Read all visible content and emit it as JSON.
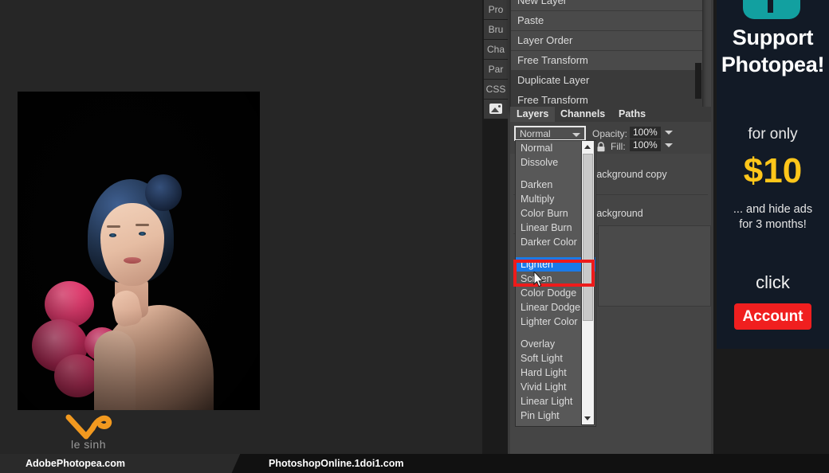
{
  "app": {
    "name": "Photopea"
  },
  "canvas": {
    "watermark_text": "le sinh",
    "logo_icon": "checkmark-swoosh-logo"
  },
  "banner": {
    "left_label": "AdobePhotopea.com",
    "right_label": "PhotoshopOnline.1doi1.com"
  },
  "tabstrip": {
    "items": [
      {
        "label": "Pro",
        "name": "properties"
      },
      {
        "label": "Bru",
        "name": "brushes"
      },
      {
        "label": "Cha",
        "name": "character"
      },
      {
        "label": "Par",
        "name": "paragraph"
      },
      {
        "label": "CSS",
        "name": "css"
      }
    ],
    "image_icon": "image-icon"
  },
  "context_menu": {
    "items": [
      {
        "label": "New Layer",
        "hovered": false
      },
      {
        "label": "Paste",
        "hovered": false
      },
      {
        "label": "Layer Order",
        "hovered": false
      },
      {
        "label": "Free Transform",
        "hovered": false
      },
      {
        "label": "Duplicate Layer",
        "hovered": true
      },
      {
        "label": "Free Transform",
        "hovered": true
      }
    ]
  },
  "panel": {
    "tabs": [
      {
        "label": "Layers",
        "active": true
      },
      {
        "label": "Channels",
        "active": false
      },
      {
        "label": "Paths",
        "active": false
      }
    ],
    "blend_mode_selected": "Normal",
    "opacity_label": "Opacity:",
    "opacity_value": "100%",
    "fill_label": "Fill:",
    "fill_value": "100%",
    "lock_icon": "lock-icon",
    "layers": [
      {
        "name": "Background copy"
      },
      {
        "name": "Background"
      }
    ]
  },
  "blend_dropdown": {
    "selected": "Lighten",
    "items": [
      {
        "label": "Normal",
        "type": "item"
      },
      {
        "label": "Dissolve",
        "type": "item"
      },
      {
        "label": "",
        "type": "separator"
      },
      {
        "label": "Darken",
        "type": "item"
      },
      {
        "label": "Multiply",
        "type": "item"
      },
      {
        "label": "Color Burn",
        "type": "item"
      },
      {
        "label": "Linear Burn",
        "type": "item"
      },
      {
        "label": "Darker Color",
        "type": "item"
      },
      {
        "label": "",
        "type": "separator"
      },
      {
        "label": "Lighten",
        "type": "item",
        "selected": true
      },
      {
        "label": "Screen",
        "type": "item"
      },
      {
        "label": "Color Dodge",
        "type": "item"
      },
      {
        "label": "Linear Dodge",
        "type": "item"
      },
      {
        "label": "Lighter Color",
        "type": "item"
      },
      {
        "label": "",
        "type": "separator"
      },
      {
        "label": "Overlay",
        "type": "item"
      },
      {
        "label": "Soft Light",
        "type": "item"
      },
      {
        "label": "Hard Light",
        "type": "item"
      },
      {
        "label": "Vivid Light",
        "type": "item"
      },
      {
        "label": "Linear Light",
        "type": "item"
      },
      {
        "label": "Pin Light",
        "type": "item"
      }
    ],
    "highlight_color": "#1a7ae8",
    "annotation_box_color": "#ee1b1b",
    "scroll_up_icon": "triangle-up-icon",
    "scroll_down_icon": "triangle-down-icon"
  },
  "ad": {
    "logo_icon": "photopea-logo",
    "title": "Support\nPhotopea!",
    "title_line1": "Support",
    "title_line2": "Photopea!",
    "for_only": "for only",
    "price": "$10",
    "note_line1": "... and hide ads",
    "note_line2": "for 3 months!",
    "click_label": "click",
    "button_label": "Account",
    "accent_color": "#ffc61a",
    "button_color": "#f01f1f",
    "logo_color": "#12a0a0"
  }
}
